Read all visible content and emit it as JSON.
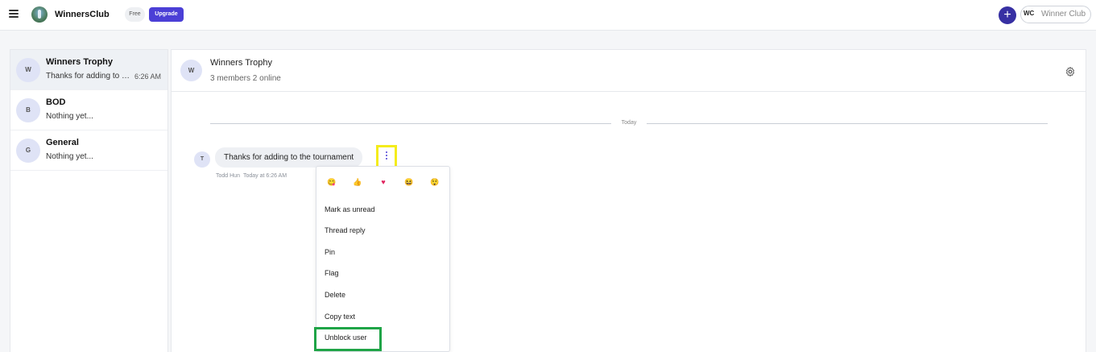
{
  "topbar": {
    "brand": "WinnersClub",
    "plan_badge": "Free",
    "upgrade_label": "Upgrade",
    "add_label": "+",
    "user_initials": "WC",
    "user_name": "Winner Club"
  },
  "channels": [
    {
      "avatar": "W",
      "title": "Winners Trophy",
      "preview": "Thanks for adding to the tournament",
      "time": "6:26 AM",
      "active": true
    },
    {
      "avatar": "B",
      "title": "BOD",
      "preview": "Nothing yet...",
      "time": ""
    },
    {
      "avatar": "G",
      "title": "General",
      "preview": "Nothing yet...",
      "time": ""
    }
  ],
  "conversation": {
    "avatar": "W",
    "title": "Winners Trophy",
    "subtitle": "3 members 2 online",
    "date_divider": "Today",
    "message": {
      "avatar": "T",
      "text": "Thanks for adding to the tournament",
      "author": "Todd Hun",
      "timestamp": "Today at 6:26 AM"
    }
  },
  "context_menu": {
    "reactions": [
      "grinning-face-emoji",
      "thumbs-up-emoji",
      "heart-emoji",
      "laughing-face-emoji",
      "surprised-face-emoji"
    ],
    "items": [
      "Mark as unread",
      "Thread reply",
      "Pin",
      "Flag",
      "Delete",
      "Copy text",
      "Unblock user"
    ]
  },
  "highlights": {
    "kebab_color": "#f4ec1c",
    "unblock_color": "#1fa447"
  },
  "colors": {
    "accent": "#4b3fd6",
    "plus_button": "#3730a3"
  }
}
